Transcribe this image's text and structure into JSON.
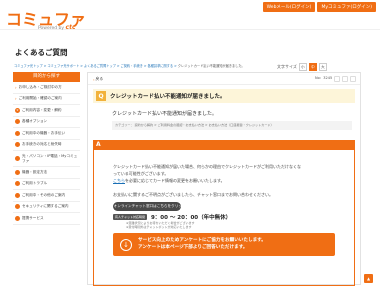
{
  "header": {
    "logo_text": "コミュファ",
    "logo_sub_prefix": "Powered by",
    "logo_sub_brand": "ctc",
    "links": [
      "Webメール(ログイン)",
      "Myコミュファ(ログイン)"
    ]
  },
  "page_title": "よくあるご質問",
  "breadcrumb": {
    "links": [
      "コミュファ光トップ",
      "コミュファ光サポート",
      "よくあるご質問トップ",
      "ご契約・手続き",
      "各種請求に関する"
    ],
    "current": "クレジットカード払い不能通知が届きました。"
  },
  "font_size": {
    "label": "文字サイズ",
    "options": [
      "小",
      "中",
      "大"
    ],
    "selected": "中"
  },
  "sidebar": {
    "header": "目的から探す",
    "items": [
      {
        "icon": "",
        "label": "お申し込み・ご検討中の方"
      },
      {
        "icon": "",
        "label": "ご利用開始・確認のご案内"
      },
      {
        "icon": "¥",
        "label": "ご利用内容・変更・解約"
      },
      {
        "icon": "",
        "label": "各種オプション"
      },
      {
        "icon": "",
        "label": "ご利用中の機器・お手伝い"
      },
      {
        "icon": "",
        "label": "お手続きの対応と紛失時"
      },
      {
        "icon": "",
        "label": "光・パソコン・IP電話・Myコミュファ"
      },
      {
        "icon": "",
        "label": "機器・設定方法"
      },
      {
        "icon": "",
        "label": "ご利用トラブル"
      },
      {
        "icon": "",
        "label": "ご利用中・その他のご案内"
      },
      {
        "icon": "",
        "label": "セキュリティに関するご案内"
      },
      {
        "icon": "",
        "label": "提携サービス"
      }
    ]
  },
  "main": {
    "back_label": "戻る",
    "qno": "No：3245",
    "question_badge": "Q",
    "question_title": "クレジットカード払い不能通知が届きました。",
    "question_body": "クレジットカード払い不能通知が届きました。",
    "category": "カテゴリー： 契約から解約 > ご利用料金の確認・お支払い方法 > お支払い方法（口座振替・クレジットカード）",
    "answer_badge": "A",
    "answer_lines": [
      "クレジットカード払い不能通知が届いた場合、何らかの理由でクレジットカードがご利用いただけなくな",
      "っている可能性がございます。",
      "必要に応じてカード情報の変更をお願いいたします。",
      "お支払いに関するご不明点がございましたら、チャット窓口までお問い合わせください。"
    ],
    "answer_link": "こちら",
    "answer_link_prefix": "を",
    "chat_label": "オンラインチャット窓口はこちらをクリック",
    "hours_tag": "有人チャット対応時間",
    "hours": "9：00 ～ 20：00（年中無休）",
    "notes": [
      "※混雑状況によりお待ちいただく場合がございます",
      "※受付時間外はチャットボットが対応いたします"
    ],
    "survey_icon": "↓",
    "survey_lines": [
      "サービス向上のためアンケートにご協力をお願いいたします。",
      "アンケートは本ページ下部よりご回答いただけます。"
    ]
  },
  "pagetop": "▲"
}
